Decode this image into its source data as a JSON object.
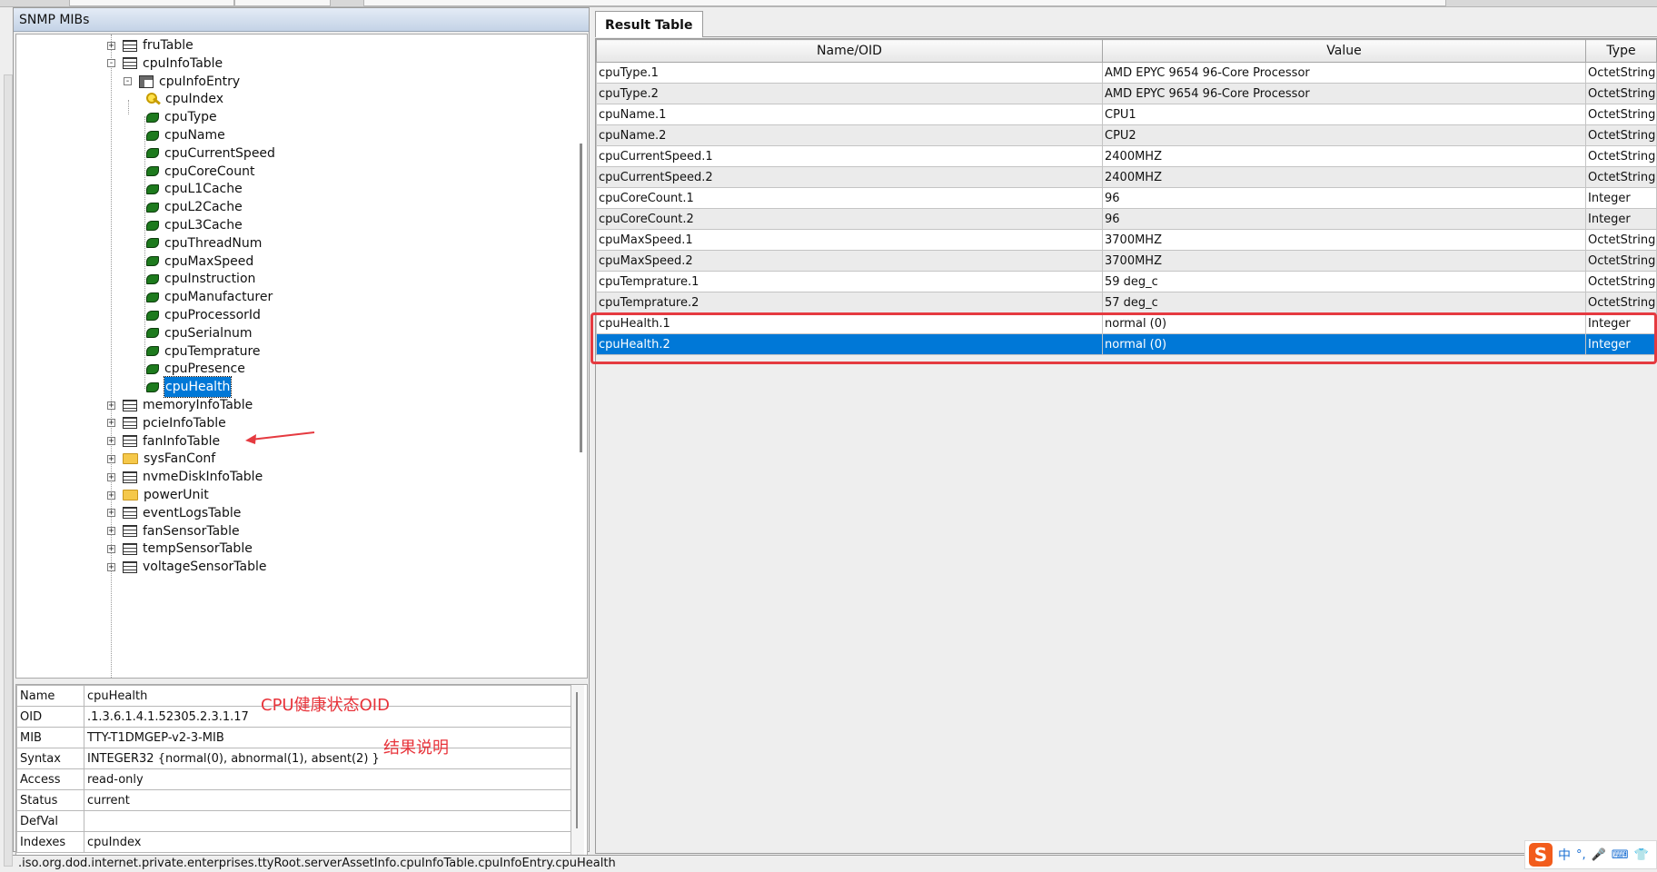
{
  "panel_title": "SNMP MIBs",
  "tree": [
    {
      "label": "fruTable",
      "icon": "table",
      "expander": "+"
    },
    {
      "label": "cpuInfoTable",
      "icon": "table",
      "expander": "-"
    },
    {
      "label": "cpuInfoEntry",
      "icon": "entry",
      "expander": "-"
    },
    {
      "label": "cpuIndex",
      "icon": "key"
    },
    {
      "label": "cpuType",
      "icon": "leaf"
    },
    {
      "label": "cpuName",
      "icon": "leaf"
    },
    {
      "label": "cpuCurrentSpeed",
      "icon": "leaf"
    },
    {
      "label": "cpuCoreCount",
      "icon": "leaf"
    },
    {
      "label": "cpuL1Cache",
      "icon": "leaf"
    },
    {
      "label": "cpuL2Cache",
      "icon": "leaf"
    },
    {
      "label": "cpuL3Cache",
      "icon": "leaf"
    },
    {
      "label": "cpuThreadNum",
      "icon": "leaf"
    },
    {
      "label": "cpuMaxSpeed",
      "icon": "leaf"
    },
    {
      "label": "cpuInstruction",
      "icon": "leaf"
    },
    {
      "label": "cpuManufacturer",
      "icon": "leaf"
    },
    {
      "label": "cpuProcessorId",
      "icon": "leaf"
    },
    {
      "label": "cpuSerialnum",
      "icon": "leaf"
    },
    {
      "label": "cpuTemprature",
      "icon": "leaf"
    },
    {
      "label": "cpuPresence",
      "icon": "leaf"
    },
    {
      "label": "cpuHealth",
      "icon": "leaf",
      "selected": true
    },
    {
      "label": "memoryInfoTable",
      "icon": "table",
      "expander": "+"
    },
    {
      "label": "pcieInfoTable",
      "icon": "table",
      "expander": "+"
    },
    {
      "label": "fanInfoTable",
      "icon": "table",
      "expander": "+"
    },
    {
      "label": "sysFanConf",
      "icon": "folder",
      "expander": "+"
    },
    {
      "label": "nvmeDiskInfoTable",
      "icon": "table",
      "expander": "+"
    },
    {
      "label": "powerUnit",
      "icon": "folder",
      "expander": "+"
    },
    {
      "label": "eventLogsTable",
      "icon": "table",
      "expander": "+"
    },
    {
      "label": "fanSensorTable",
      "icon": "table",
      "expander": "+"
    },
    {
      "label": "tempSensorTable",
      "icon": "table",
      "expander": "+"
    },
    {
      "label": "voltageSensorTable",
      "icon": "table",
      "expander": "+"
    }
  ],
  "properties": [
    {
      "key": "Name",
      "value": "cpuHealth"
    },
    {
      "key": "OID",
      "value": ".1.3.6.1.4.1.52305.2.3.1.17"
    },
    {
      "key": "MIB",
      "value": "TTY-T1DMGEP-v2-3-MIB"
    },
    {
      "key": "Syntax",
      "value": "INTEGER32 {normal(0), abnormal(1), absent(2) }"
    },
    {
      "key": "Access",
      "value": "read-only"
    },
    {
      "key": "Status",
      "value": "current"
    },
    {
      "key": "DefVal",
      "value": ""
    },
    {
      "key": "Indexes",
      "value": "cpuIndex"
    }
  ],
  "annotations": {
    "oid_note": "CPU健康状态OID",
    "syntax_note": "结果说明"
  },
  "result_tab": "Result Table",
  "result_columns": [
    "Name/OID",
    "Value",
    "Type"
  ],
  "result_rows": [
    {
      "name": "cpuType.1",
      "value": "AMD EPYC 9654 96-Core Processor",
      "type": "OctetString"
    },
    {
      "name": "cpuType.2",
      "value": "AMD EPYC 9654 96-Core Processor",
      "type": "OctetString"
    },
    {
      "name": "cpuName.1",
      "value": "CPU1",
      "type": "OctetString"
    },
    {
      "name": "cpuName.2",
      "value": "CPU2",
      "type": "OctetString"
    },
    {
      "name": "cpuCurrentSpeed.1",
      "value": "2400MHZ",
      "type": "OctetString"
    },
    {
      "name": "cpuCurrentSpeed.2",
      "value": "2400MHZ",
      "type": "OctetString"
    },
    {
      "name": "cpuCoreCount.1",
      "value": "96",
      "type": "Integer"
    },
    {
      "name": "cpuCoreCount.2",
      "value": "96",
      "type": "Integer"
    },
    {
      "name": "cpuMaxSpeed.1",
      "value": "3700MHZ",
      "type": "OctetString"
    },
    {
      "name": "cpuMaxSpeed.2",
      "value": "3700MHZ",
      "type": "OctetString"
    },
    {
      "name": "cpuTemprature.1",
      "value": "59 deg_c",
      "type": "OctetString"
    },
    {
      "name": "cpuTemprature.2",
      "value": "57 deg_c",
      "type": "OctetString"
    },
    {
      "name": "cpuHealth.1",
      "value": "normal (0)",
      "type": "Integer"
    },
    {
      "name": "cpuHealth.2",
      "value": "normal (0)",
      "type": "Integer",
      "selected": true
    }
  ],
  "status_path": ".iso.org.dod.internet.private.enterprises.ttyRoot.serverAssetInfo.cpuInfoTable.cpuInfoEntry.cpuHealth",
  "ime": {
    "logo": "S",
    "lang": "中"
  },
  "colors": {
    "selection": "#0078d7",
    "annotation_red": "#e53a40",
    "leaf_green": "#1d7a1d"
  }
}
